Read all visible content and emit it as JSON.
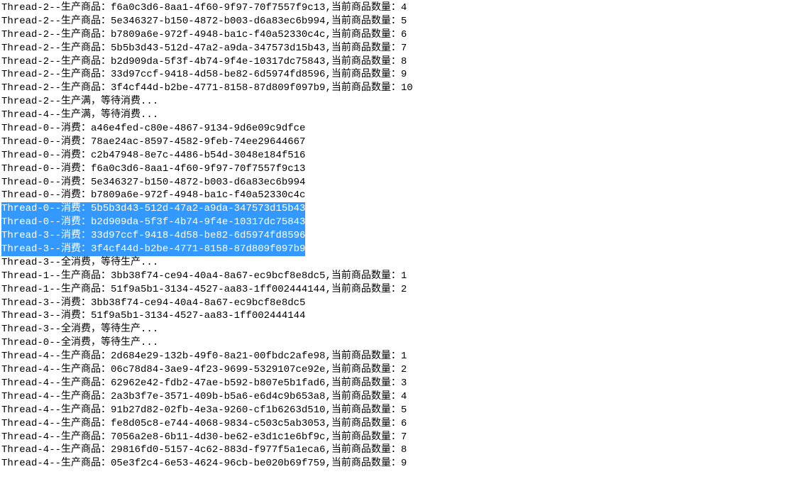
{
  "log_lines": [
    {
      "text": "Thread-2--生产商品：f6a0c3d6-8aa1-4f60-9f97-70f7557f9c13,当前商品数量：4",
      "highlighted": false
    },
    {
      "text": "Thread-2--生产商品：5e346327-b150-4872-b003-d6a83ec6b994,当前商品数量：5",
      "highlighted": false
    },
    {
      "text": "Thread-2--生产商品：b7809a6e-972f-4948-ba1c-f40a52330c4c,当前商品数量：6",
      "highlighted": false
    },
    {
      "text": "Thread-2--生产商品：5b5b3d43-512d-47a2-a9da-347573d15b43,当前商品数量：7",
      "highlighted": false
    },
    {
      "text": "Thread-2--生产商品：b2d909da-5f3f-4b74-9f4e-10317dc75843,当前商品数量：8",
      "highlighted": false
    },
    {
      "text": "Thread-2--生产商品：33d97ccf-9418-4d58-be82-6d5974fd8596,当前商品数量：9",
      "highlighted": false
    },
    {
      "text": "Thread-2--生产商品：3f4cf44d-b2be-4771-8158-87d809f097b9,当前商品数量：10",
      "highlighted": false
    },
    {
      "text": "Thread-2--生产满，等待消费...",
      "highlighted": false
    },
    {
      "text": "Thread-4--生产满，等待消费...",
      "highlighted": false
    },
    {
      "text": "Thread-0--消费：a46e4fed-c80e-4867-9134-9d6e09c9dfce",
      "highlighted": false
    },
    {
      "text": "Thread-0--消费：78ae24ac-8597-4582-9feb-74ee29644667",
      "highlighted": false
    },
    {
      "text": "Thread-0--消费：c2b47948-8e7c-4486-b54d-3048e184f516",
      "highlighted": false
    },
    {
      "text": "Thread-0--消费：f6a0c3d6-8aa1-4f60-9f97-70f7557f9c13",
      "highlighted": false
    },
    {
      "text": "Thread-0--消费：5e346327-b150-4872-b003-d6a83ec6b994",
      "highlighted": false
    },
    {
      "text": "Thread-0--消费：b7809a6e-972f-4948-ba1c-f40a52330c4c",
      "highlighted": false
    },
    {
      "text": "Thread-0--消费：5b5b3d43-512d-47a2-a9da-347573d15b43",
      "highlighted": true
    },
    {
      "text": "Thread-0--消费：b2d909da-5f3f-4b74-9f4e-10317dc75843",
      "highlighted": true
    },
    {
      "text": "Thread-3--消费：33d97ccf-9418-4d58-be82-6d5974fd8596",
      "highlighted": true
    },
    {
      "text": "Thread-3--消费：3f4cf44d-b2be-4771-8158-87d809f097b9",
      "highlighted": true
    },
    {
      "text": "Thread-3--全消费，等待生产...",
      "highlighted": false
    },
    {
      "text": "Thread-1--生产商品：3bb38f74-ce94-40a4-8a67-ec9bcf8e8dc5,当前商品数量：1",
      "highlighted": false
    },
    {
      "text": "Thread-1--生产商品：51f9a5b1-3134-4527-aa83-1ff002444144,当前商品数量：2",
      "highlighted": false
    },
    {
      "text": "Thread-3--消费：3bb38f74-ce94-40a4-8a67-ec9bcf8e8dc5",
      "highlighted": false
    },
    {
      "text": "Thread-3--消费：51f9a5b1-3134-4527-aa83-1ff002444144",
      "highlighted": false
    },
    {
      "text": "Thread-3--全消费，等待生产...",
      "highlighted": false
    },
    {
      "text": "Thread-0--全消费，等待生产...",
      "highlighted": false
    },
    {
      "text": "Thread-4--生产商品：2d684e29-132b-49f0-8a21-00fbdc2afe98,当前商品数量：1",
      "highlighted": false
    },
    {
      "text": "Thread-4--生产商品：06c78d84-3ae9-4f23-9699-5329107ce92e,当前商品数量：2",
      "highlighted": false
    },
    {
      "text": "Thread-4--生产商品：62962e42-fdb2-47ae-b592-b807e5b1fad6,当前商品数量：3",
      "highlighted": false
    },
    {
      "text": "Thread-4--生产商品：2a3b3f7e-3571-409b-b5a6-e6d4c9b653a8,当前商品数量：4",
      "highlighted": false
    },
    {
      "text": "Thread-4--生产商品：91b27d82-02fb-4e3a-9260-cf1b6263d510,当前商品数量：5",
      "highlighted": false
    },
    {
      "text": "Thread-4--生产商品：fe8d05c8-e744-4068-9834-c503c5ab3053,当前商品数量：6",
      "highlighted": false
    },
    {
      "text": "Thread-4--生产商品：7056a2e8-6b11-4d30-be62-e3d1c1e6bf9c,当前商品数量：7",
      "highlighted": false
    },
    {
      "text": "Thread-4--生产商品：29816fd0-5157-4c62-883d-f977f5a1eca6,当前商品数量：8",
      "highlighted": false
    },
    {
      "text": "Thread-4--生产商品：05e3f2c4-6e53-4624-96cb-be020b69f759,当前商品数量：9",
      "highlighted": false
    }
  ]
}
